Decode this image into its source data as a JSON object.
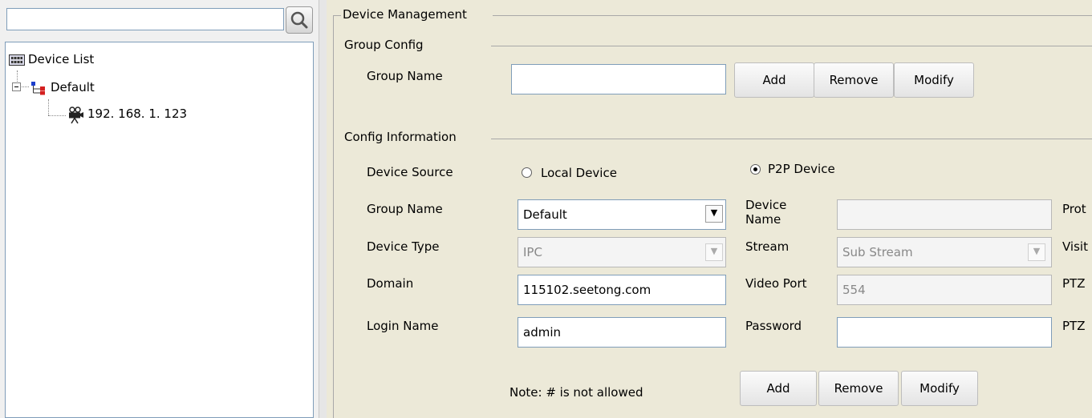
{
  "search": {
    "placeholder": ""
  },
  "tree": {
    "root_label": "Device List",
    "group_label": "Default",
    "device_label": "192. 168. 1. 123"
  },
  "device_management": {
    "title": "Device Management",
    "group_config": {
      "title": "Group Config",
      "group_name_label": "Group Name",
      "group_name_value": "",
      "add_label": "Add",
      "remove_label": "Remove",
      "modify_label": "Modify"
    },
    "config_info": {
      "title": "Config Information",
      "device_source_label": "Device Source",
      "local_device_label": "Local Device",
      "p2p_device_label": "P2P Device",
      "selected_source": "P2P Device",
      "group_name_label": "Group Name",
      "group_name_value": "Default",
      "device_name_label": "Device Name",
      "device_name_value": "",
      "device_type_label": "Device Type",
      "device_type_value": "IPC",
      "stream_label": "Stream",
      "stream_value": "Sub Stream",
      "domain_label": "Domain",
      "domain_value": "115102.seetong.com",
      "video_port_label": "Video Port",
      "video_port_value": "554",
      "login_name_label": "Login Name",
      "login_name_value": "admin",
      "password_label": "Password",
      "password_value": "",
      "clipped_labels": [
        "Prot",
        "Visit",
        "PTZ",
        "PTZ"
      ],
      "note": "Note: # is not allowed",
      "add_label": "Add",
      "remove_label": "Remove",
      "modify_label": "Modify"
    }
  },
  "colors": {
    "panel_bg": "#ece9d8",
    "field_border": "#7f9db9"
  },
  "icons": [
    "search-icon",
    "device-list-icon",
    "group-icon",
    "camera-icon"
  ]
}
